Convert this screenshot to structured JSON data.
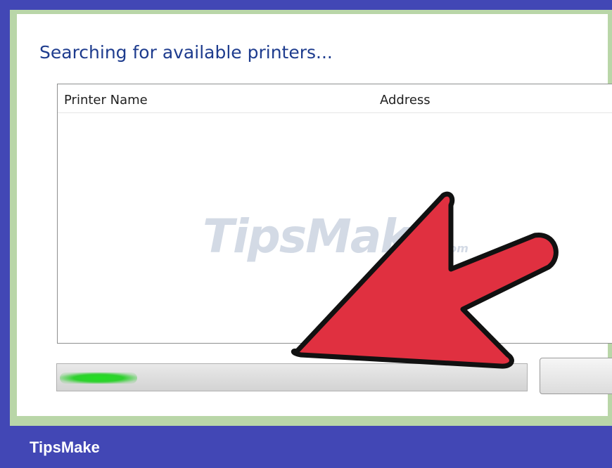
{
  "dialog": {
    "title": "Searching for available printers..."
  },
  "printer_list": {
    "columns": [
      "Printer Name",
      "Address"
    ],
    "rows": []
  },
  "progress": {
    "state": "indeterminate",
    "indicator_color": "#2ed02e"
  },
  "annotation": {
    "arrow_color": "#e03040",
    "arrow_points_to": "progress-bar"
  },
  "watermark": {
    "main": "TipsMake",
    "suffix": ".com"
  },
  "footer": {
    "brand": "TipsMake",
    "background_color": "#4247b5"
  }
}
